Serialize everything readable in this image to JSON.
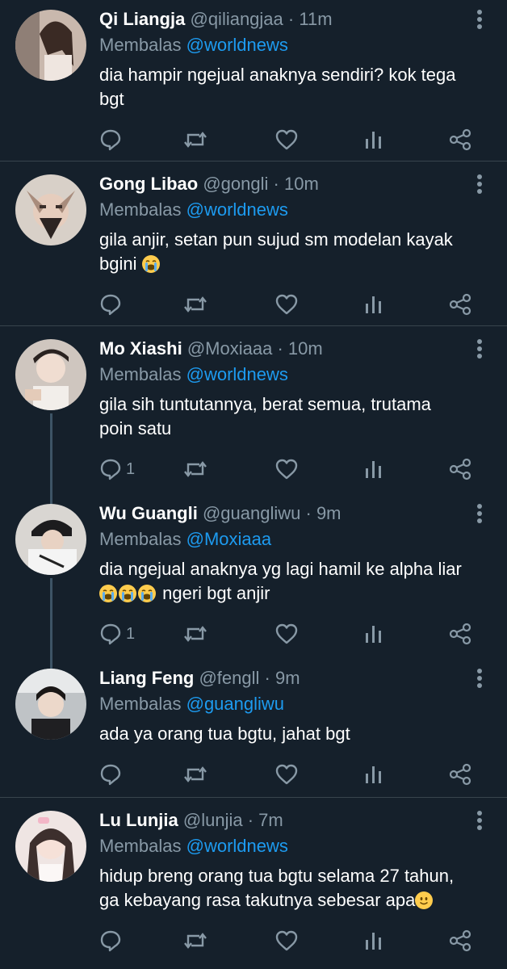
{
  "reply_label": "Membalas",
  "tweets": [
    {
      "name": "Qi Liangja",
      "handle": "@qiliangjaa",
      "time": "11m",
      "reply_to": "@worldnews",
      "text_lines": [
        "dia hampir ngejual anaknya sendiri? kok tega",
        "bgt"
      ],
      "reply_count": ""
    },
    {
      "name": "Gong Libao",
      "handle": "@gongli",
      "time": "10m",
      "reply_to": "@worldnews",
      "text_lines": [
        "gila anjir, setan pun sujud sm modelan kayak",
        "bgini"
      ],
      "emoji_after_line2": [
        "loudly-crying-face"
      ],
      "reply_count": ""
    },
    {
      "name": "Mo Xiashi",
      "handle": "@Moxiaaa",
      "time": "10m",
      "reply_to": "@worldnews",
      "text_lines": [
        "gila sih tuntutannya, berat semua, trutama",
        "poin satu"
      ],
      "reply_count": "1"
    },
    {
      "name": "Wu Guangli",
      "handle": "@guangliwu",
      "time": "9m",
      "reply_to": "@Moxiaaa",
      "text_lines": [
        "dia ngejual anaknya yg lagi hamil ke alpha liar",
        "ngeri bgt anjir"
      ],
      "emoji_before_line2": [
        "loudly-crying-face",
        "loudly-crying-face",
        "loudly-crying-face"
      ],
      "reply_count": "1"
    },
    {
      "name": "Liang Feng",
      "handle": "@fengll",
      "time": "9m",
      "reply_to": "@guangliwu",
      "text_lines": [
        "ada ya orang tua bgtu, jahat bgt"
      ],
      "reply_count": ""
    },
    {
      "name": "Lu Lunjia",
      "handle": "@lunjia",
      "time": "7m",
      "reply_to": "@worldnews",
      "text_lines": [
        "hidup breng orang tua bgtu selama 27 tahun,",
        "ga kebayang rasa takutnya sebesar apa"
      ],
      "emoji_after_line2": [
        "slightly-smiling-face"
      ],
      "reply_count": ""
    }
  ],
  "icons": {
    "reply": "speech-bubble-icon",
    "retweet": "retweet-icon",
    "like": "heart-icon",
    "views": "bar-chart-icon",
    "share": "share-icon",
    "more": "vertical-dots-icon"
  },
  "colors": {
    "background": "#15202b",
    "divider": "#38444d",
    "secondary_text": "#8899a6",
    "link": "#1d9bf0",
    "icon": "#8899a6"
  }
}
